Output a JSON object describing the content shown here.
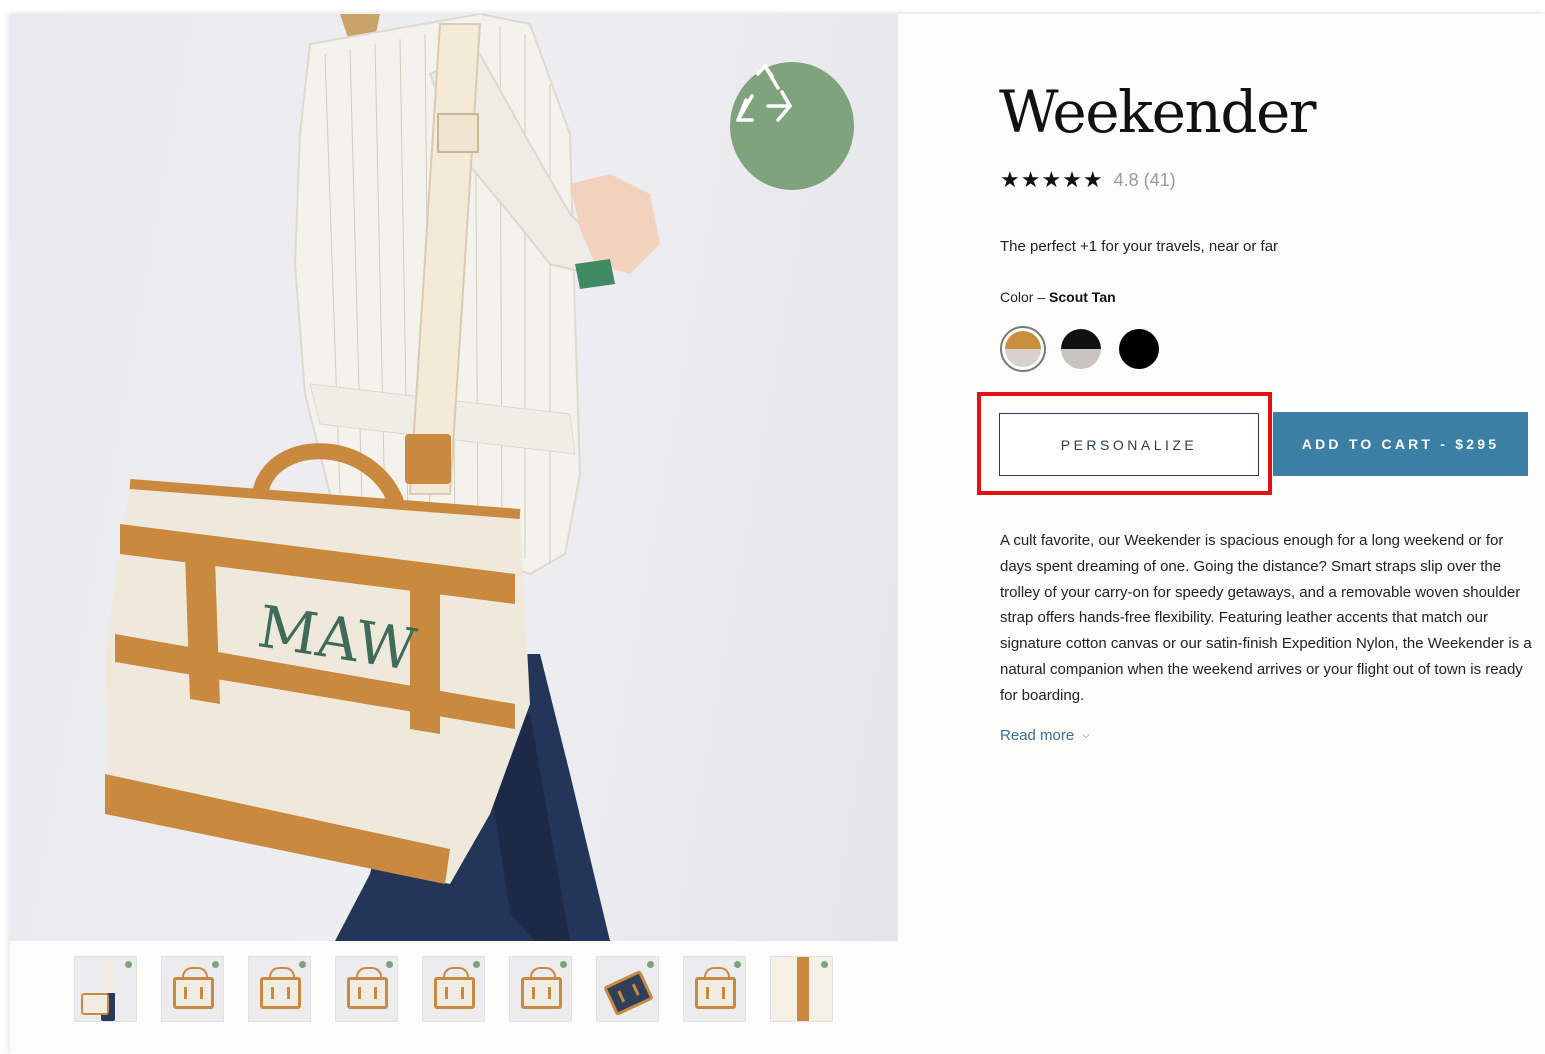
{
  "product": {
    "title": "Weekender",
    "stars": "★★★★★",
    "rating_score": "4.8",
    "rating_count": "(41)",
    "tagline": "The perfect +1 for your travels, near or far",
    "color_label": "Color –",
    "color_value": "Scout Tan",
    "swatches": [
      {
        "name": "Scout Tan",
        "top": "#c98f3d",
        "bottom": "#d8d2cb",
        "selected": true
      },
      {
        "name": "Black / Grey",
        "top": "#111111",
        "bottom": "#c9c3c0",
        "selected": false
      },
      {
        "name": "Black",
        "top": "#000000",
        "bottom": "#000000",
        "selected": false
      }
    ],
    "personalize_label": "PERSONALIZE",
    "cart_label": "ADD TO CART - $295",
    "description": "A cult favorite, our Weekender is spacious enough for a long weekend or for days spent dreaming of one. Going the distance? Smart straps slip over the trolley of your carry-on for speedy getaways, and a removable woven shoulder strap offers hands-free flexibility. Featuring leather accents that match our signature cotton canvas or our satin-finish Expedition Nylon, the Weekender is a natural companion when the weekend arrives or your flight out of town is ready for boarding.",
    "read_more": "Read more"
  },
  "image": {
    "monogram": "MAW",
    "badge_icon": "recycle-icon"
  },
  "thumbnails": [
    "model-wearing",
    "front",
    "front-alt",
    "monogram",
    "detail",
    "angle",
    "open-interior",
    "front-small",
    "strap-closeup"
  ],
  "colors": {
    "accent": "#3b7fa5",
    "leather": "#c98a3f",
    "badge": "#7fa37d",
    "highlight": "#e31212",
    "monogram": "#3f6b5a"
  }
}
